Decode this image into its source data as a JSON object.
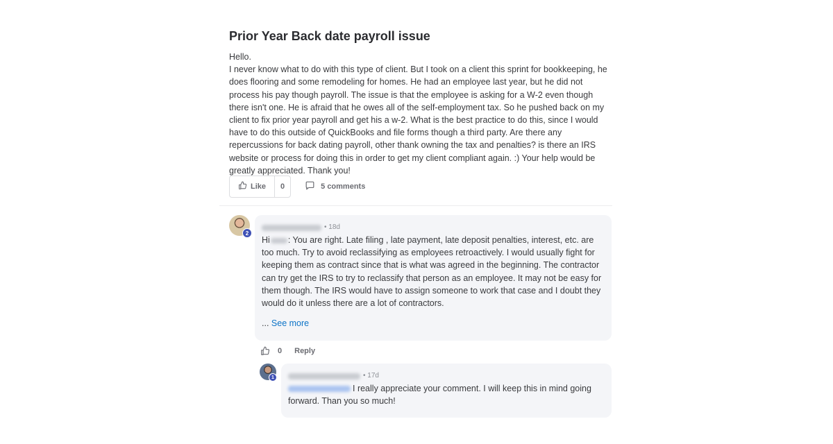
{
  "post": {
    "title": "Prior Year Back date payroll issue",
    "greeting": "Hello.",
    "body": "I never know what to do with this type of client. But I took on a client this sprint for bookkeeping, he does flooring and some remodeling for homes. He had an employee last year, but he did not process his pay though payroll. The issue is that the employee is asking for a W-2 even though there isn't one. He is afraid that he owes all of the self-employment tax. So he pushed back on my client to fix prior year payroll and get his a w-2. What is the best practice to do this, since I would have to do this outside of QuickBooks and file forms though a third party. Are there any repercussions for back dating payroll, other thank owning the tax and penalties? is there an IRS website or process for doing this in order to get my client compliant again. :) Your help would be greatly appreciated. Thank you!"
  },
  "actions": {
    "like_label": "Like",
    "like_count": "0",
    "comments_label": "5 comments"
  },
  "comments": [
    {
      "badge": "2",
      "time": "• 18d",
      "text_prefix": "Hi",
      "text": ": You are right. Late filing , late payment, late deposit penalties, interest, etc. are too much. Try to avoid reclassifying as employees retroactively. I would usually fight for keeping them as contract since that is what was agreed in the beginning. The contractor can try get the IRS to try to reclassify that person as an employee. It may not be easy for them though. The IRS would have to assign someone to work that case and I doubt they would do it unless there are a lot of contractors.",
      "see_more_prefix": "...",
      "see_more_label": "See more",
      "like_count": "0",
      "reply_label": "Reply"
    },
    {
      "badge": "1",
      "time": "• 17d",
      "text": "I really appreciate your comment. I will keep this in mind going forward. Than you so much!"
    }
  ],
  "icons": {
    "like": "thumbs-up-icon",
    "comments": "speech-bubble-icon"
  },
  "colors": {
    "link": "#0d74c7",
    "badge": "#3f51b5",
    "card_bg": "#f4f5f8"
  }
}
